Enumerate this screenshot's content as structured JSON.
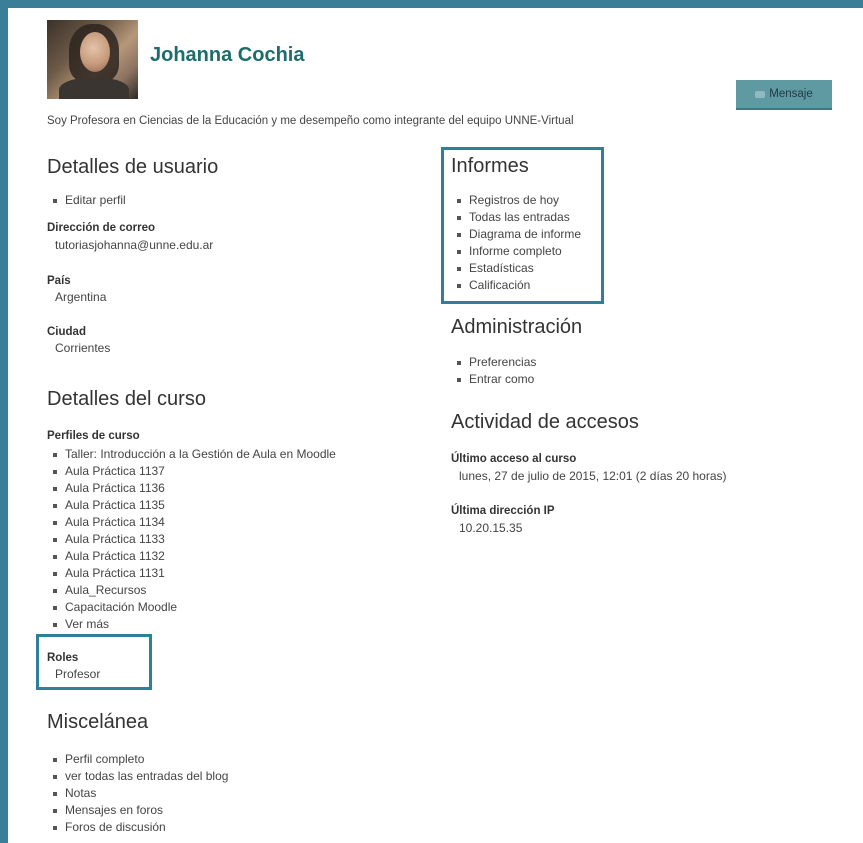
{
  "profile": {
    "name": "Johanna Cochia",
    "description": "Soy Profesora en Ciencias de la Educación y me desempeño como integrante del equipo UNNE-Virtual",
    "message_button": "Mensaje"
  },
  "user_details": {
    "title": "Detalles de usuario",
    "items": [
      "Editar perfil"
    ],
    "email_label": "Dirección de correo",
    "email_value": "tutoriasjohanna@unne.edu.ar",
    "country_label": "País",
    "country_value": "Argentina",
    "city_label": "Ciudad",
    "city_value": "Corrientes"
  },
  "course_details": {
    "title": "Detalles del curso",
    "profiles_label": "Perfiles de curso",
    "courses": [
      "Taller: Introducción a la Gestión de Aula en Moodle",
      "Aula Práctica 1137",
      "Aula Práctica 1136",
      "Aula Práctica 1135",
      "Aula Práctica 1134",
      "Aula Práctica 1133",
      "Aula Práctica 1132",
      "Aula Práctica 1131",
      "Aula_Recursos",
      "Capacitación Moodle",
      "Ver más"
    ],
    "roles_label": "Roles",
    "roles_value": "Profesor"
  },
  "misc": {
    "title": "Miscelánea",
    "items": [
      "Perfil completo",
      "ver todas las entradas del blog",
      "Notas",
      "Mensajes en foros",
      "Foros de discusión"
    ]
  },
  "reports": {
    "title": "Informes",
    "items": [
      "Registros de hoy",
      "Todas las entradas",
      "Diagrama de informe",
      "Informe completo",
      "Estadísticas",
      "Calificación"
    ]
  },
  "administration": {
    "title": "Administración",
    "items": [
      "Preferencias",
      "Entrar como"
    ]
  },
  "access": {
    "title": "Actividad de accesos",
    "last_access_label": "Último acceso al curso",
    "last_access_value": "lunes, 27 de julio de 2015, 12:01  (2 días 20 horas)",
    "last_ip_label": "Última dirección IP",
    "last_ip_value": "10.20.15.35"
  },
  "colors": {
    "name": "#1c6d6b",
    "highlight_border": "#2f7f99",
    "button_bg": "#5f9aa2"
  }
}
